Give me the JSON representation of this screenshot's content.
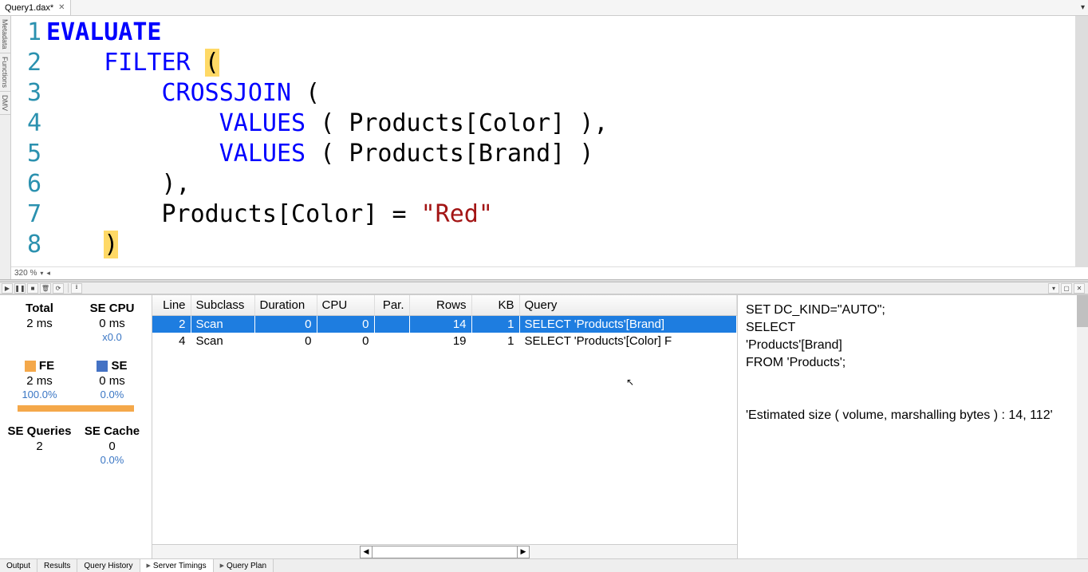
{
  "tab": {
    "title": "Query1.dax*",
    "close": "✕"
  },
  "sidebar": {
    "tabs": [
      "Metadata",
      "Functions",
      "DMV"
    ]
  },
  "editor": {
    "zoom": "320 %",
    "lines": [
      "1",
      "2",
      "3",
      "4",
      "5",
      "6",
      "7",
      "8"
    ],
    "code": {
      "evaluate": "EVALUATE",
      "filter": "FILTER",
      "crossjoin": "CROSSJOIN",
      "values": "VALUES",
      "prod_color": "Products[Color]",
      "prod_brand": "Products[Brand]",
      "eq": " = ",
      "red": "\"Red\""
    }
  },
  "stats": {
    "total_label": "Total",
    "total_val": "2 ms",
    "secpu_label": "SE CPU",
    "secpu_val": "0 ms",
    "secpu_sub": "x0.0",
    "fe_label": "FE",
    "fe_val": "2 ms",
    "fe_sub": "100.0%",
    "se_label": "SE",
    "se_val": "0 ms",
    "se_sub": "0.0%",
    "seq_label": "SE Queries",
    "seq_val": "2",
    "secache_label": "SE Cache",
    "secache_val": "0",
    "secache_sub": "0.0%"
  },
  "table": {
    "headers": {
      "line": "Line",
      "subclass": "Subclass",
      "duration": "Duration",
      "cpu": "CPU",
      "par": "Par.",
      "rows": "Rows",
      "kb": "KB",
      "query": "Query"
    },
    "rows": [
      {
        "line": "2",
        "subclass": "Scan",
        "duration": "0",
        "cpu": "0",
        "par": "",
        "rows": "14",
        "kb": "1",
        "query": "SELECT 'Products'[Brand] "
      },
      {
        "line": "4",
        "subclass": "Scan",
        "duration": "0",
        "cpu": "0",
        "par": "",
        "rows": "19",
        "kb": "1",
        "query": "SELECT 'Products'[Color] F"
      }
    ]
  },
  "detail": {
    "line1": "SET DC_KIND=\"AUTO\";",
    "line2": "SELECT",
    "line3": "'Products'[Brand]",
    "line4": "FROM 'Products';",
    "line5": "'Estimated size ( volume, marshalling bytes ) : 14, 112'"
  },
  "bottom_tabs": {
    "output": "Output",
    "results": "Results",
    "history": "Query History",
    "timings": "Server Timings",
    "plan": "Query Plan"
  }
}
